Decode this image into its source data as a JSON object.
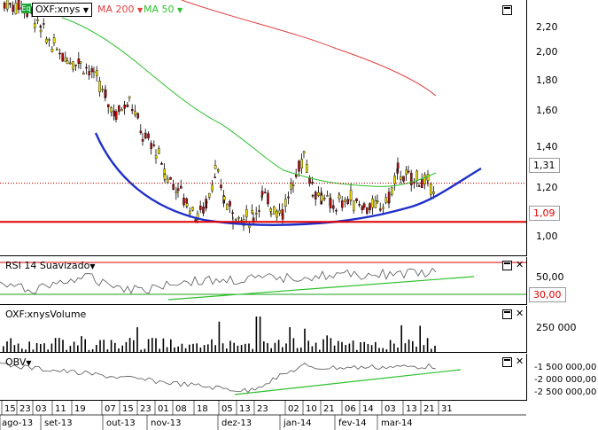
{
  "main_panel": {
    "symbol_badge": "Eq",
    "symbol": "OXF:xnys",
    "ma200": "MA 200",
    "ma50": "MA 50",
    "price_tag_current": "1,31",
    "price_tag_support": "1,09",
    "yaxis_ticks": [
      "2,20",
      "2,00",
      "1,80",
      "1,60",
      "1,40",
      "1,20",
      "1,00"
    ],
    "colors": {
      "ma200": "#e04040",
      "ma50": "#2ec02e",
      "arc": "#1f2fc8",
      "support": "#e00000"
    }
  },
  "rsi_panel": {
    "title": "RSI 14 Suavizado",
    "tick": "50,00",
    "tag": "30,00"
  },
  "volume_panel": {
    "title": "OXF:xnysVolume",
    "tick": "250 000"
  },
  "obv_panel": {
    "title": "OBV",
    "ticks": [
      "-1 500 000,00",
      "-2 000 000,00",
      "-2 500 000,00"
    ]
  },
  "x_axis": {
    "day_labels": [
      "15",
      "23",
      "03",
      "11",
      "19",
      "07",
      "15",
      "23",
      "01",
      "08",
      "18",
      "05",
      "13",
      "23",
      "02",
      "10",
      "21",
      "06",
      "14",
      "03",
      "13",
      "21",
      "31"
    ],
    "month_labels": [
      "ago-13",
      "set-13",
      "out-13",
      "nov-13",
      "dez-13",
      "jan-14",
      "fev-14",
      "mar-14"
    ]
  },
  "chart_data": {
    "type": "candlestick",
    "yaxis": {
      "min": 0.9,
      "max": 2.35
    },
    "levels": {
      "current": 1.31,
      "support": 1.09
    }
  }
}
